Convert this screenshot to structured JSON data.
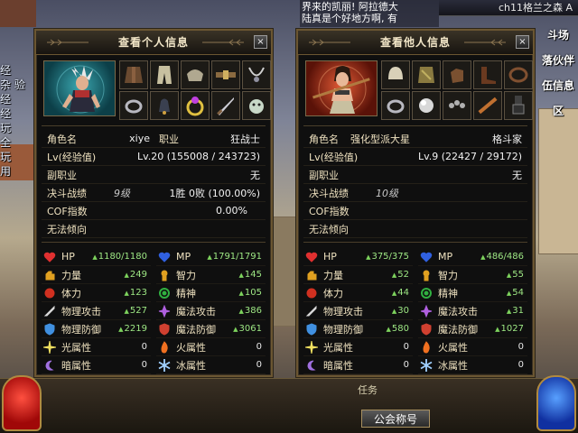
{
  "top": {
    "chat_lines": [
      "界来的凯丽! 阿拉德大",
      "陆真是个好地方啊, 有"
    ],
    "channel": "ch11格兰之森 A",
    "right_menu": [
      "斗场",
      "落伙伴",
      "伍信息",
      "区"
    ],
    "left_text": [
      "经",
      "杂 验",
      "经",
      "经",
      "玩",
      "全",
      "玩",
      "用"
    ]
  },
  "hud": {
    "quest_label": "任务",
    "guild_button": "公会称号"
  },
  "self_panel": {
    "title": "查看个人信息",
    "close": "×",
    "name_label": "角色名",
    "name": "xiye",
    "job_label": "职业",
    "job": "狂战士",
    "lv_label": "Lv(经验值)",
    "lv": "Lv.20 (155008 / 243723)",
    "sub_job_label": "副职业",
    "sub_job": "无",
    "duel_label": "决斗战绩",
    "duel_grade": "9级",
    "duel_record": "1胜 0败 (100.00%)",
    "cof_label": "COF指数",
    "cof": "0.00%",
    "law_label": "无法倾向",
    "stats": [
      {
        "name": "HP",
        "value": "1180/1180",
        "up": true,
        "icon": "heart-icon",
        "color": "#e03030"
      },
      {
        "name": "MP",
        "value": "1791/1791",
        "up": true,
        "icon": "mana-heart-icon",
        "color": "#3060e0"
      },
      {
        "name": "力量",
        "value": "249",
        "up": true,
        "icon": "strength-icon",
        "color": "#e0a020"
      },
      {
        "name": "智力",
        "value": "145",
        "up": true,
        "icon": "intelligence-icon",
        "color": "#e0a020"
      },
      {
        "name": "体力",
        "value": "123",
        "up": true,
        "icon": "vitality-icon",
        "color": "#d03020"
      },
      {
        "name": "精神",
        "value": "105",
        "up": true,
        "icon": "spirit-icon",
        "color": "#30b040"
      },
      {
        "name": "物理攻击",
        "value": "527",
        "up": true,
        "icon": "sword-icon",
        "color": "#d8d8d8"
      },
      {
        "name": "魔法攻击",
        "value": "386",
        "up": true,
        "icon": "magic-attack-icon",
        "color": "#b060e0"
      },
      {
        "name": "物理防御",
        "value": "2219",
        "up": true,
        "icon": "shield-icon",
        "color": "#4090e0"
      },
      {
        "name": "魔法防御",
        "value": "3061",
        "up": true,
        "icon": "magic-defense-icon",
        "color": "#d04030"
      },
      {
        "name": "光属性",
        "value": "0",
        "up": false,
        "icon": "light-element-icon",
        "color": "#f0e060"
      },
      {
        "name": "火属性",
        "value": "0",
        "up": false,
        "icon": "fire-element-icon",
        "color": "#f07020"
      },
      {
        "name": "暗属性",
        "value": "0",
        "up": false,
        "icon": "dark-element-icon",
        "color": "#a070e0"
      },
      {
        "name": "冰属性",
        "value": "0",
        "up": false,
        "icon": "ice-element-icon",
        "color": "#a0d0ff"
      }
    ]
  },
  "other_panel": {
    "title": "查看他人信息",
    "close": "×",
    "name_label": "角色名",
    "name": "强化型派大星",
    "job": "格斗家",
    "lv_label": "Lv(经验值)",
    "lv": "Lv.9 (22427 / 29172)",
    "sub_job_label": "副职业",
    "sub_job": "无",
    "duel_label": "决斗战绩",
    "duel_grade": "10级",
    "cof_label": "COF指数",
    "law_label": "无法倾向",
    "stats": [
      {
        "name": "HP",
        "value": "375/375",
        "up": true,
        "icon": "heart-icon",
        "color": "#e03030"
      },
      {
        "name": "MP",
        "value": "486/486",
        "up": true,
        "icon": "mana-heart-icon",
        "color": "#3060e0"
      },
      {
        "name": "力量",
        "value": "52",
        "up": true,
        "icon": "strength-icon",
        "color": "#e0a020"
      },
      {
        "name": "智力",
        "value": "55",
        "up": true,
        "icon": "intelligence-icon",
        "color": "#e0a020"
      },
      {
        "name": "体力",
        "value": "44",
        "up": true,
        "icon": "vitality-icon",
        "color": "#d03020"
      },
      {
        "name": "精神",
        "value": "54",
        "up": true,
        "icon": "spirit-icon",
        "color": "#30b040"
      },
      {
        "name": "物理攻击",
        "value": "30",
        "up": true,
        "icon": "sword-icon",
        "color": "#d8d8d8"
      },
      {
        "name": "魔法攻击",
        "value": "31",
        "up": true,
        "icon": "magic-attack-icon",
        "color": "#b060e0"
      },
      {
        "name": "物理防御",
        "value": "580",
        "up": true,
        "icon": "shield-icon",
        "color": "#4090e0"
      },
      {
        "name": "魔法防御",
        "value": "1027",
        "up": true,
        "icon": "magic-defense-icon",
        "color": "#d04030"
      },
      {
        "name": "光属性",
        "value": "0",
        "up": false,
        "icon": "light-element-icon",
        "color": "#f0e060"
      },
      {
        "name": "火属性",
        "value": "0",
        "up": false,
        "icon": "fire-element-icon",
        "color": "#f07020"
      },
      {
        "name": "暗属性",
        "value": "0",
        "up": false,
        "icon": "dark-element-icon",
        "color": "#a070e0"
      },
      {
        "name": "冰属性",
        "value": "0",
        "up": false,
        "icon": "ice-element-icon",
        "color": "#a0d0ff"
      }
    ]
  }
}
